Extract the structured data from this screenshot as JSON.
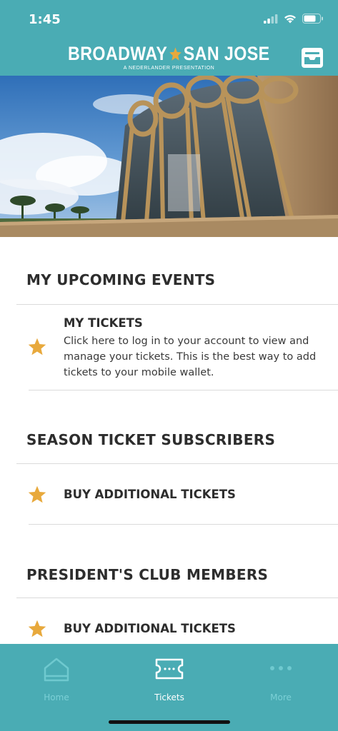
{
  "status_bar": {
    "time": "1:45"
  },
  "header": {
    "logo_left": "BROADWAY",
    "logo_right": "SAN JOSE",
    "logo_tagline": "A NEDERLANDER PRESENTATION"
  },
  "sections": {
    "upcoming": {
      "title": "MY UPCOMING EVENTS",
      "item_title": "MY TICKETS",
      "item_desc": "Click here to log in to your account to view and manage your tickets. This is the best way to add tickets to your mobile wallet."
    },
    "subscribers": {
      "title": "SEASON TICKET SUBSCRIBERS",
      "item_title": "BUY ADDITIONAL TICKETS"
    },
    "presidents": {
      "title": "PRESIDENT'S CLUB MEMBERS",
      "item_title": "BUY ADDITIONAL TICKETS"
    }
  },
  "tabbar": {
    "tabs": [
      {
        "label": "Home",
        "icon": "home-icon",
        "active": false
      },
      {
        "label": "Tickets",
        "icon": "ticket-icon",
        "active": true
      },
      {
        "label": "More",
        "icon": "more-icon",
        "active": false
      }
    ]
  },
  "colors": {
    "brand_teal": "#4aacb4",
    "star_gold": "#e8a93c",
    "text_dark": "#2d2d2d"
  }
}
